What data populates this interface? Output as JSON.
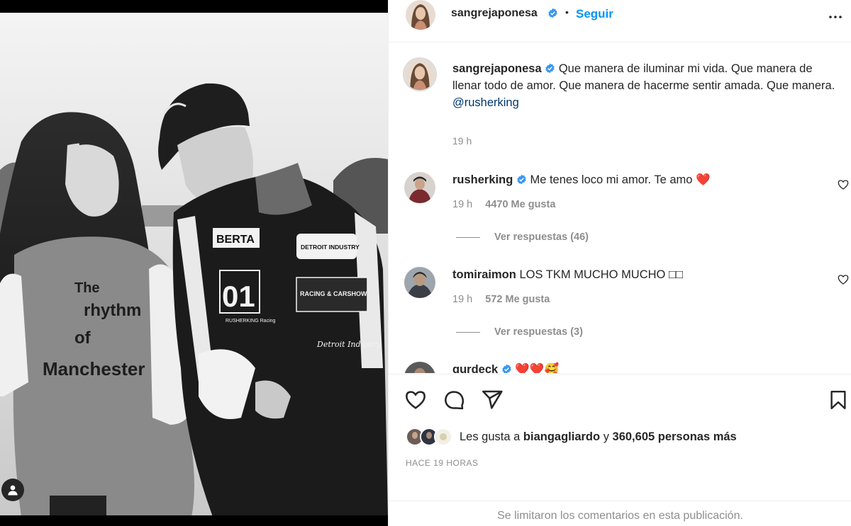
{
  "post": {
    "author": "sangrejaponesa",
    "follow_label": "Seguir",
    "dot": "•",
    "caption_text": "Que manera de iluminar mi vida. Que manera de llenar todo de amor. Que manera de hacerme sentir amada. Que manera.",
    "caption_mention": "@rusherking",
    "caption_time": "19 h",
    "photo": {
      "shirt_lines": [
        "The",
        "rhythm",
        "of",
        "Manchester"
      ],
      "jacket_number": "01",
      "jacket_patches": [
        "BERTA",
        "DETROIT INDUSTRY",
        "RACING & CARSHOW",
        "Detroit Industry",
        "RUSHERKING Racing"
      ]
    }
  },
  "comments": [
    {
      "user": "rusherking",
      "verified": true,
      "text": "Me tenes loco mi amor. Te amo",
      "emoji": "❤️",
      "time": "19 h",
      "likes": "4470 Me gusta",
      "replies": "Ver respuestas (46)"
    },
    {
      "user": "tomiraimon",
      "verified": false,
      "text": "LOS TKM MUCHO MUCHO",
      "emoji": "□□",
      "time": "19 h",
      "likes": "572 Me gusta",
      "replies": "Ver respuestas (3)"
    },
    {
      "user": "gurdeck",
      "verified": true,
      "text": "",
      "emoji": "❤️❤️🥰",
      "time": "",
      "likes": "",
      "replies": ""
    }
  ],
  "likes": {
    "prefix": "Les gusta a",
    "user": "biangagliardo",
    "connector": "y",
    "count": "360,605 personas más"
  },
  "timestamp": "HACE 19 HORAS",
  "comments_limited": "Se limitaron los comentarios en esta publicación.",
  "colors": {
    "accent": "#0095f6",
    "verified": "#3897f0",
    "heart": "#ed1c24",
    "muted": "#8e8e8e",
    "mention": "#00376b"
  },
  "icons": {
    "more": "more-horizontal-icon",
    "like": "heart-outline-icon",
    "comment": "comment-bubble-icon",
    "share": "paper-plane-icon",
    "save": "bookmark-icon",
    "tag": "user-tag-icon"
  }
}
